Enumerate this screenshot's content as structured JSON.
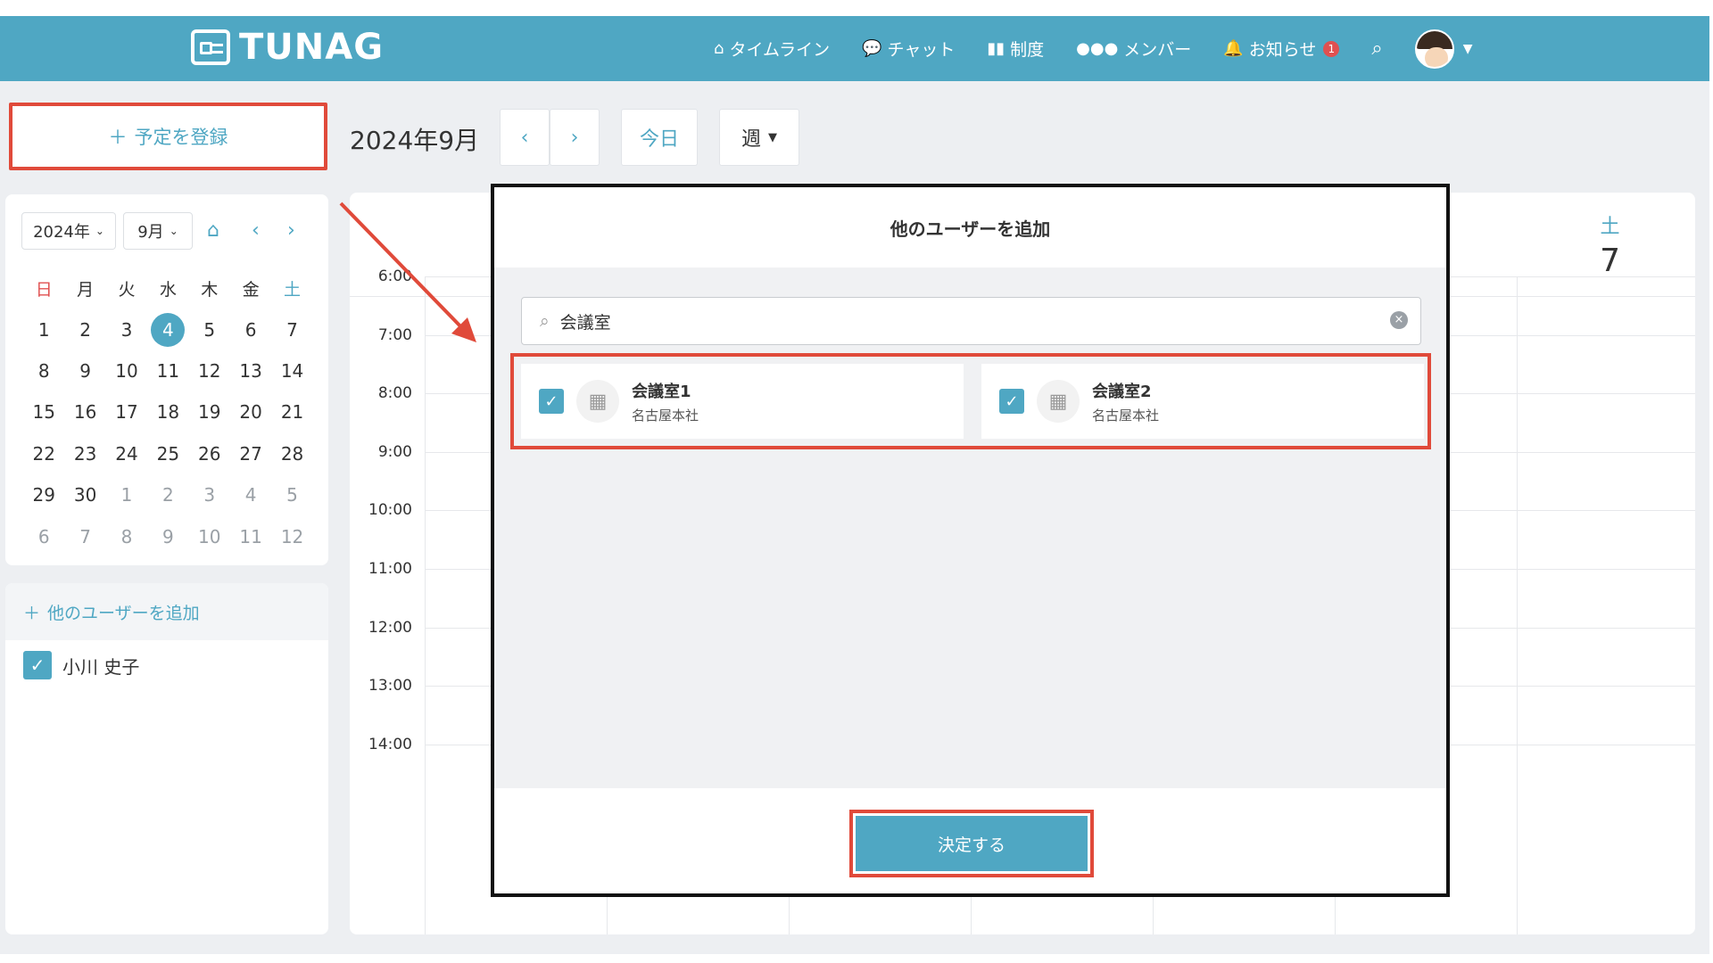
{
  "header": {
    "brand": "TUNAG",
    "nav": [
      {
        "label": "タイムライン",
        "icon": "home-icon"
      },
      {
        "label": "チャット",
        "icon": "chat-icon"
      },
      {
        "label": "制度",
        "icon": "book-icon"
      },
      {
        "label": "メンバー",
        "icon": "members-icon"
      },
      {
        "label": "お知らせ",
        "icon": "bell-icon"
      }
    ],
    "notification_count": "1"
  },
  "toolbar": {
    "add_event_label": "予定を登録",
    "month_title": "2024年9月",
    "prev": "‹",
    "next": "›",
    "today_label": "今日",
    "view_label": "週"
  },
  "mini_calendar": {
    "year_select": "2024年",
    "month_select": "9月",
    "weekdays": [
      "日",
      "月",
      "火",
      "水",
      "木",
      "金",
      "土"
    ],
    "days": [
      [
        "1",
        "2",
        "3",
        "4",
        "5",
        "6",
        "7"
      ],
      [
        "8",
        "9",
        "10",
        "11",
        "12",
        "13",
        "14"
      ],
      [
        "15",
        "16",
        "17",
        "18",
        "19",
        "20",
        "21"
      ],
      [
        "22",
        "23",
        "24",
        "25",
        "26",
        "27",
        "28"
      ],
      [
        "29",
        "30",
        "1",
        "2",
        "3",
        "4",
        "5"
      ],
      [
        "6",
        "7",
        "8",
        "9",
        "10",
        "11",
        "12"
      ]
    ],
    "today": "4"
  },
  "users_panel": {
    "add_label": "他のユーザーを追加",
    "users": [
      {
        "name": "小川 史子",
        "checked": true
      }
    ]
  },
  "week_view": {
    "saturday_label": "土",
    "saturday_date": "7",
    "times": [
      "6:00",
      "7:00",
      "8:00",
      "9:00",
      "10:00",
      "11:00",
      "12:00",
      "13:00",
      "14:00"
    ]
  },
  "modal": {
    "title": "他のユーザーを追加",
    "search_value": "会議室",
    "results": [
      {
        "name": "会議室1",
        "location": "名古屋本社",
        "checked": true
      },
      {
        "name": "会議室2",
        "location": "名古屋本社",
        "checked": true
      }
    ],
    "confirm_label": "決定する"
  },
  "colors": {
    "accent": "#4fa7c3",
    "highlight": "#e04a3a",
    "sunday": "#e05050"
  }
}
